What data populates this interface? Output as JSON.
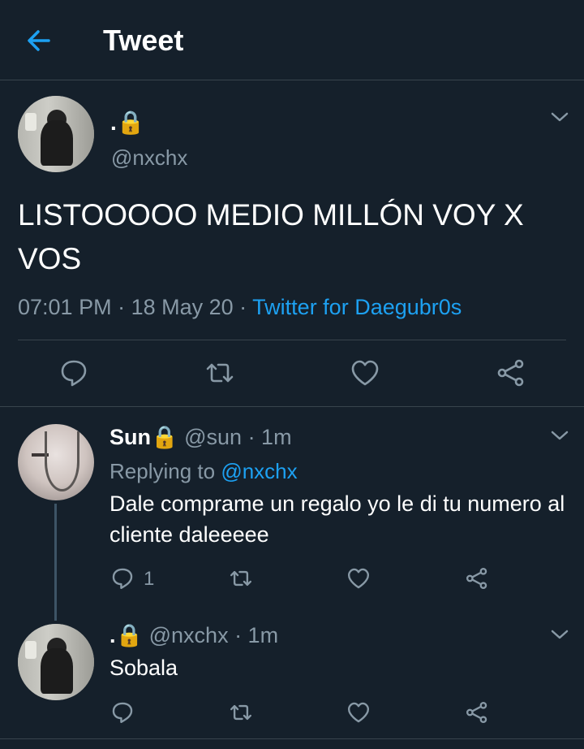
{
  "header": {
    "title": "Tweet",
    "back_icon": "arrow-left-icon",
    "accent": "#1da1f2"
  },
  "tweet": {
    "name": ".🔒",
    "handle": "@nxchx",
    "text": "LISTOOOOO MEDIO MILLÓN VOY X VOS",
    "time": "07:01 PM",
    "dot1": " · ",
    "date": "18 May 20",
    "dot2": " · ",
    "app": "Twitter for Daegubr0s",
    "actions": [
      "reply-icon",
      "retweet-icon",
      "like-icon",
      "share-icon"
    ]
  },
  "replies": [
    {
      "name": "Sun🔒",
      "meta": " @sun · 1m",
      "replying_prefix": "Replying to ",
      "replying_to": "@nxchx",
      "text": "Dale comprame un regalo yo le di tu numero al cliente daleeeee",
      "reply_count": "1"
    },
    {
      "name": ".🔒",
      "meta": " @nxchx · 1m",
      "text": "Sobala"
    }
  ],
  "colors": {
    "background": "#15202b",
    "muted": "#8899a6",
    "divider": "#38444d"
  }
}
